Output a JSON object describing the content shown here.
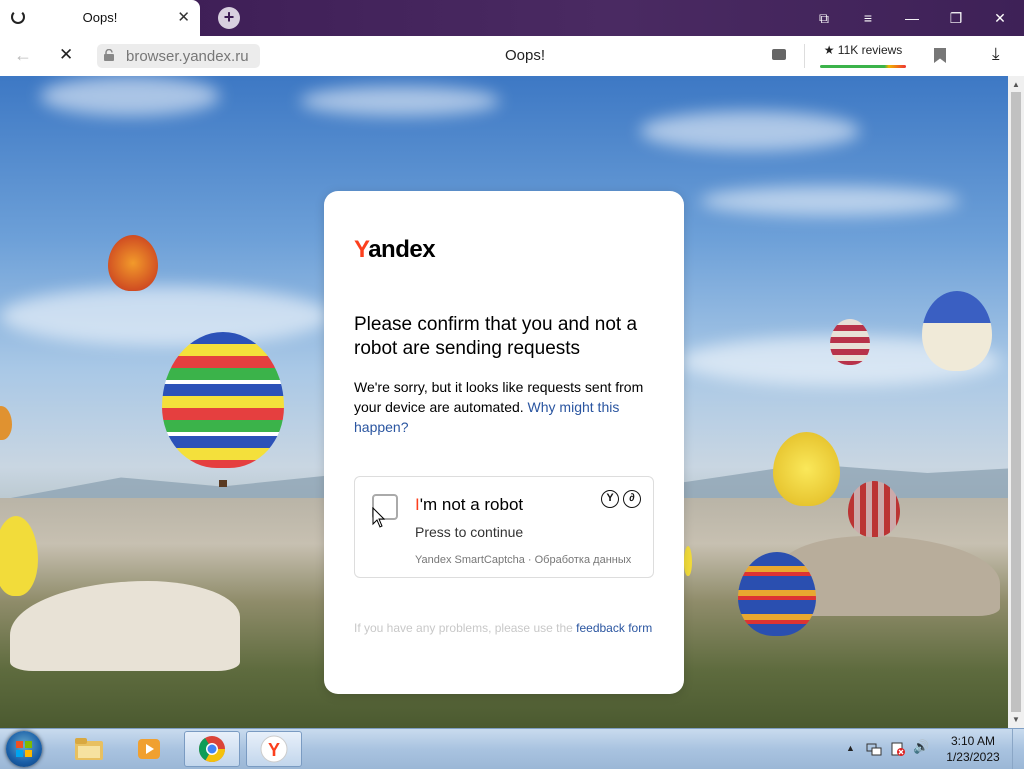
{
  "browser": {
    "tab": {
      "title": "Oops!",
      "close": "✕"
    },
    "new_tab": "+",
    "window_controls": {
      "collections": "⧉",
      "menu": "≡",
      "minimize": "—",
      "restore": "❐",
      "close": "✕"
    },
    "address": {
      "back": "←",
      "stop": "✕",
      "url": "browser.yandex.ru",
      "page_title": "Oops!",
      "reviews": "★ 11K reviews",
      "download": "⤓"
    }
  },
  "captcha": {
    "logo_first": "Y",
    "logo_rest": "andex",
    "heading": "Please confirm that you and not a robot are sending requests",
    "description": "We're sorry, but it looks like requests sent from your device are automated.",
    "why_link": "Why might this happen?",
    "checkbox_label_first": "I",
    "checkbox_label_rest": "'m not a robot",
    "press_to_continue": "Press to continue",
    "smartcaptcha": "Yandex SmartCaptcha · Обработка данных",
    "feedback_prefix": "If you have any problems, please use the",
    "feedback_link": "feedback form"
  },
  "taskbar": {
    "clock_time": "3:10 AM",
    "clock_date": "1/23/2023",
    "tray_arrow": "▲",
    "volume": "🔊"
  },
  "colors": {
    "brand_red": "#fc3f1d",
    "link_blue": "#2a55a0",
    "tab_strip": "#3a1a52"
  }
}
